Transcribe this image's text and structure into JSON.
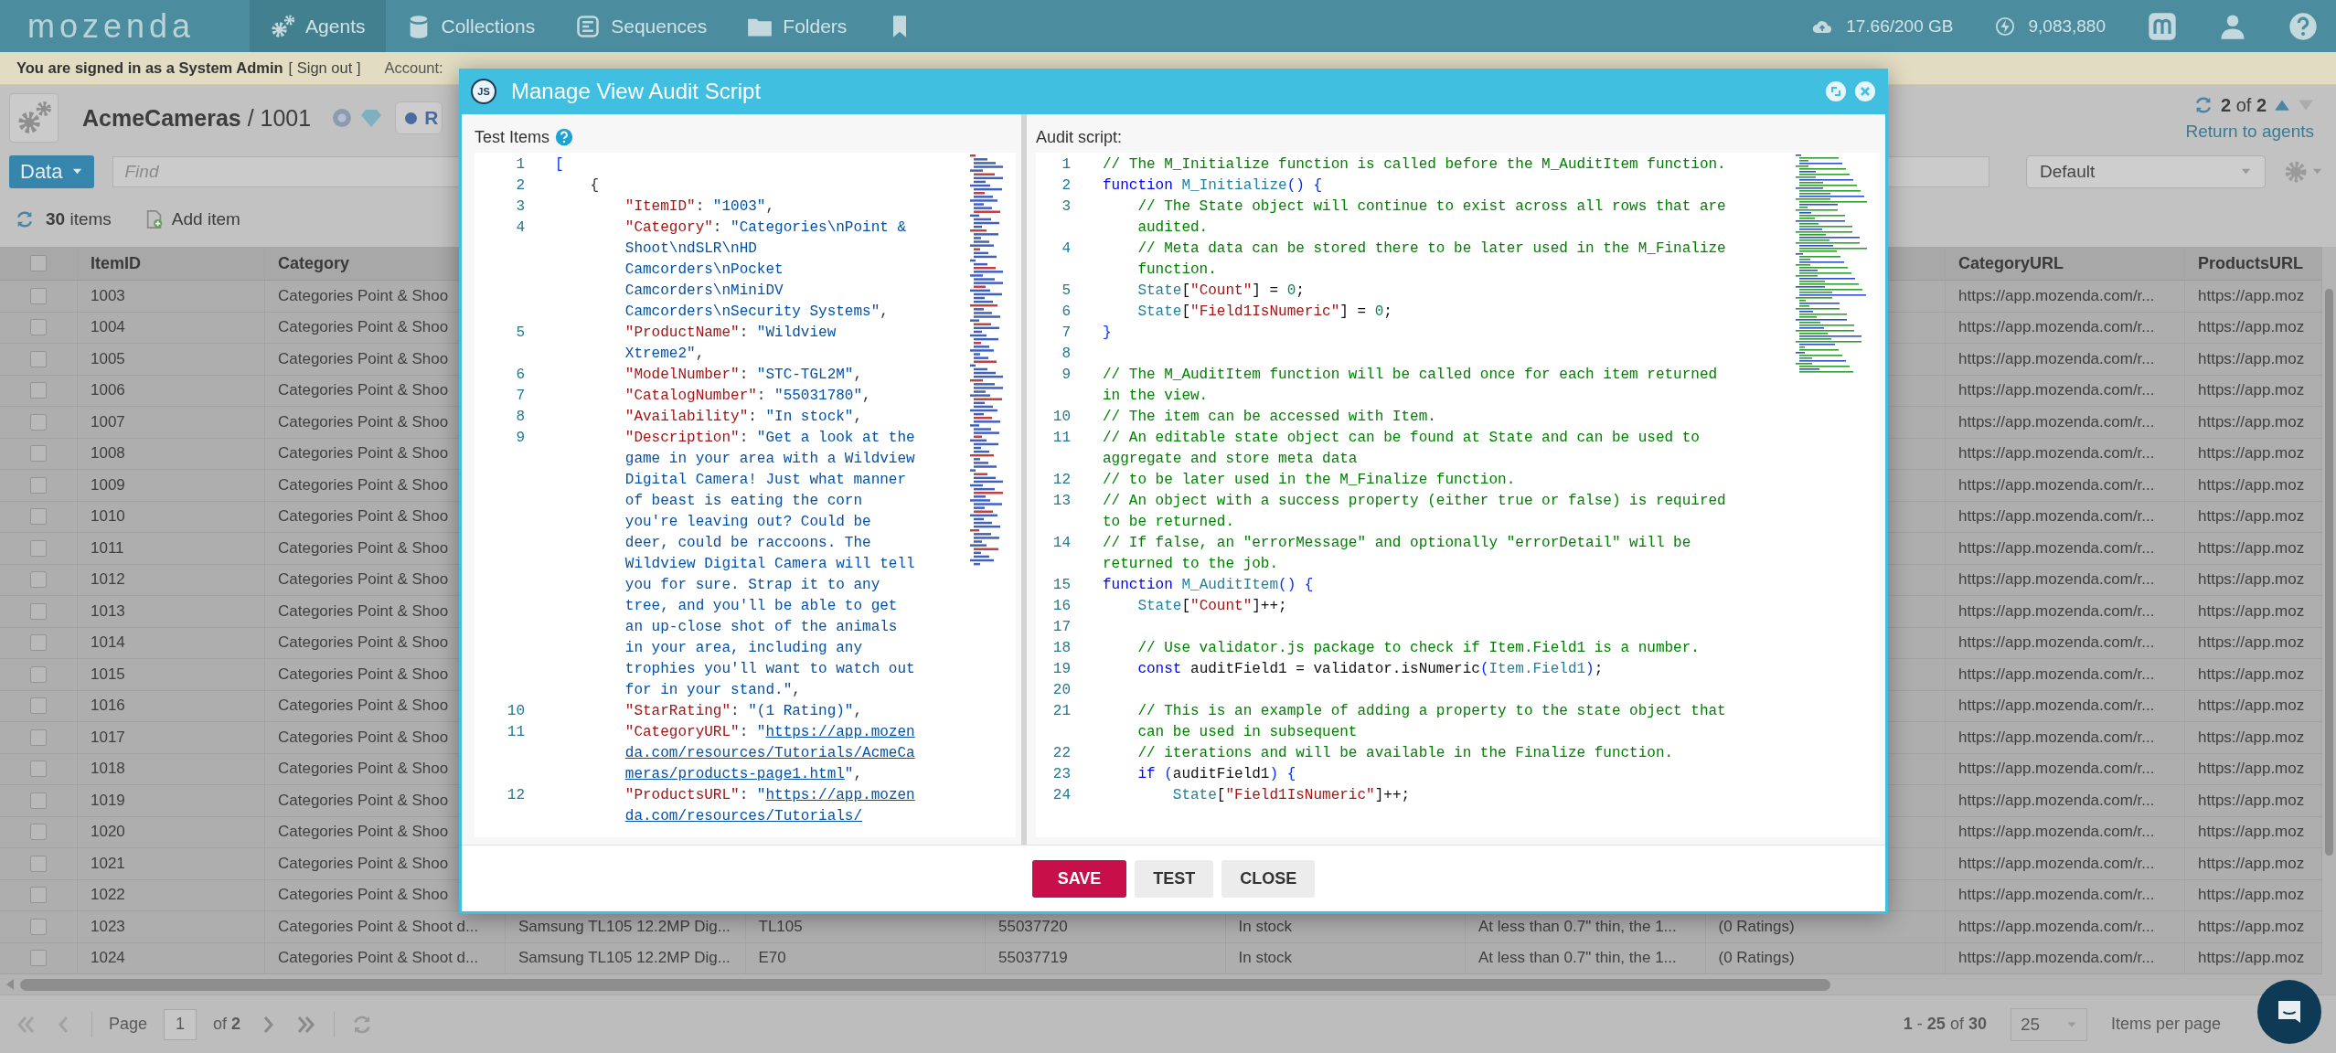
{
  "topbar": {
    "logo": "mozenda",
    "nav": [
      {
        "label": "Agents",
        "selected": true
      },
      {
        "label": "Collections",
        "selected": false
      },
      {
        "label": "Sequences",
        "selected": false
      },
      {
        "label": "Folders",
        "selected": false
      },
      {
        "selected": false
      }
    ],
    "storage": "17.66/200 GB",
    "credits": "9,083,880"
  },
  "admin_bar": {
    "signed_in": "You are signed in as a System Admin",
    "sign_out": "[ Sign out ]",
    "account_label": "Account:"
  },
  "view_header": {
    "title": "**AcmeCameras** / 1001",
    "chip": "R",
    "position": "**2** of **2**",
    "return_link": "Return to agents",
    "data_button": "Data",
    "find_placeholder": "Find",
    "view_select": "Default",
    "item_count": "**30** items",
    "add_item": "Add item"
  },
  "table": {
    "select_all_checked": false,
    "columns_left": [
      "ItemID",
      "Category"
    ],
    "columns_right": [
      "CategoryURL",
      "ProductsURL"
    ],
    "rows": [
      {
        "checked": false,
        "item_id": "1003",
        "category": "Categories Point & Shoo",
        "category_url": "https://app.mozenda.com/r...",
        "products_url": "https://app.moz"
      },
      {
        "checked": false,
        "item_id": "1004",
        "category": "Categories Point & Shoo",
        "category_url": "https://app.mozenda.com/r...",
        "products_url": "https://app.moz"
      },
      {
        "checked": false,
        "item_id": "1005",
        "category": "Categories Point & Shoo",
        "category_url": "https://app.mozenda.com/r...",
        "products_url": "https://app.moz"
      },
      {
        "checked": false,
        "item_id": "1006",
        "category": "Categories Point & Shoo",
        "category_url": "https://app.mozenda.com/r...",
        "products_url": "https://app.moz"
      },
      {
        "checked": false,
        "item_id": "1007",
        "category": "Categories Point & Shoo",
        "category_url": "https://app.mozenda.com/r...",
        "products_url": "https://app.moz"
      },
      {
        "checked": false,
        "item_id": "1008",
        "category": "Categories Point & Shoo",
        "category_url": "https://app.mozenda.com/r...",
        "products_url": "https://app.moz"
      },
      {
        "checked": false,
        "item_id": "1009",
        "category": "Categories Point & Shoo",
        "category_url": "https://app.mozenda.com/r...",
        "products_url": "https://app.moz"
      },
      {
        "checked": false,
        "item_id": "1010",
        "category": "Categories Point & Shoo",
        "category_url": "https://app.mozenda.com/r...",
        "products_url": "https://app.moz"
      },
      {
        "checked": false,
        "item_id": "1011",
        "category": "Categories Point & Shoo",
        "category_url": "https://app.mozenda.com/r...",
        "products_url": "https://app.moz"
      },
      {
        "checked": false,
        "item_id": "1012",
        "category": "Categories Point & Shoo",
        "category_url": "https://app.mozenda.com/r...",
        "products_url": "https://app.moz"
      },
      {
        "checked": false,
        "item_id": "1013",
        "category": "Categories Point & Shoo",
        "category_url": "https://app.mozenda.com/r...",
        "products_url": "https://app.moz"
      },
      {
        "checked": false,
        "item_id": "1014",
        "category": "Categories Point & Shoo",
        "category_url": "https://app.mozenda.com/r...",
        "products_url": "https://app.moz"
      },
      {
        "checked": false,
        "item_id": "1015",
        "category": "Categories Point & Shoo",
        "category_url": "https://app.mozenda.com/r...",
        "products_url": "https://app.moz"
      },
      {
        "checked": false,
        "item_id": "1016",
        "category": "Categories Point & Shoo",
        "category_url": "https://app.mozenda.com/r...",
        "products_url": "https://app.moz"
      },
      {
        "checked": false,
        "item_id": "1017",
        "category": "Categories Point & Shoo",
        "category_url": "https://app.mozenda.com/r...",
        "products_url": "https://app.moz"
      },
      {
        "checked": false,
        "item_id": "1018",
        "category": "Categories Point & Shoo",
        "category_url": "https://app.mozenda.com/r...",
        "products_url": "https://app.moz"
      },
      {
        "checked": false,
        "item_id": "1019",
        "category": "Categories Point & Shoo",
        "category_url": "https://app.mozenda.com/r...",
        "products_url": "https://app.moz"
      },
      {
        "checked": false,
        "item_id": "1020",
        "category": "Categories Point & Shoo",
        "category_url": "https://app.mozenda.com/r...",
        "products_url": "https://app.moz"
      },
      {
        "checked": false,
        "item_id": "1021",
        "category": "Categories Point & Shoo",
        "category_url": "https://app.mozenda.com/r...",
        "products_url": "https://app.moz"
      },
      {
        "checked": false,
        "item_id": "1022",
        "category": "Categories Point & Shoo",
        "category_url": "https://app.mozenda.com/r...",
        "products_url": "https://app.moz"
      },
      {
        "checked": false,
        "item_id": "1023",
        "category": "Categories Point & Shoot d...",
        "column_3": "Samsung TL105 12.2MP Dig...",
        "column_4": "TL105",
        "column_5": "55037720",
        "column_6": "In stock",
        "column_7": "At less than 0.7\" thin, the 1...",
        "column_8": "(0 Ratings)",
        "category_url": "https://app.mozenda.com/r...",
        "products_url": "https://app.moz"
      },
      {
        "checked": false,
        "item_id": "1024",
        "category": "Categories Point & Shoot d...",
        "column_3": "Samsung TL105 12.2MP Dig...",
        "column_4": "E70",
        "column_5": "55037719",
        "column_6": "In stock",
        "column_7": "At less than 0.7\" thin, the 1...",
        "column_8": "(0 Ratings)",
        "category_url": "https://app.mozenda.com/r...",
        "products_url": "https://app.moz"
      }
    ]
  },
  "pager": {
    "page_label": "Page",
    "page": "1",
    "page_total": "of **2**",
    "range": "**1** - **25** of **30**",
    "per_page": "25",
    "per_page_label": "Items per page"
  },
  "modal": {
    "icon_label": "JS",
    "title": "Manage View Audit Script",
    "buttons": [
      {
        "label": "SAVE",
        "kind": "primary"
      },
      {
        "label": "TEST",
        "kind": "plain"
      },
      {
        "label": "CLOSE",
        "kind": "plain"
      }
    ],
    "test_items": {
      "label": "Test Items",
      "lines": [
        {
          "num": "1",
          "tokens": [
            {
              "kind": "bracket",
              "text": "["
            }
          ]
        },
        {
          "num": "2",
          "tokens": [
            {
              "kind": "punct",
              "text": "    {"
            }
          ]
        },
        {
          "num": "3",
          "tokens": [
            {
              "kind": "key",
              "text": "        \"ItemID\""
            },
            {
              "kind": "punct",
              "text": ": "
            },
            {
              "kind": "str",
              "text": "\"1003\""
            },
            {
              "kind": "punct",
              "text": ","
            }
          ]
        },
        {
          "num": "4",
          "tokens": [
            {
              "kind": "key",
              "text": "        \"Category\""
            },
            {
              "kind": "punct",
              "text": ": "
            },
            {
              "kind": "str",
              "text": "\"Categories\\nPoint & Shoot\\ndSLR\\nHD Camcorders\\nPocket Camcorders\\nMiniDV Camcorders\\nSecurity Systems\""
            },
            {
              "kind": "punct",
              "text": ","
            }
          ]
        },
        {
          "num": "5",
          "tokens": [
            {
              "kind": "key",
              "text": "        \"ProductName\""
            },
            {
              "kind": "punct",
              "text": ": "
            },
            {
              "kind": "str",
              "text": "\"Wildview Xtreme2\""
            },
            {
              "kind": "punct",
              "text": ","
            }
          ]
        },
        {
          "num": "6",
          "tokens": [
            {
              "kind": "key",
              "text": "        \"ModelNumber\""
            },
            {
              "kind": "punct",
              "text": ": "
            },
            {
              "kind": "str",
              "text": "\"STC-TGL2M\""
            },
            {
              "kind": "punct",
              "text": ","
            }
          ]
        },
        {
          "num": "7",
          "tokens": [
            {
              "kind": "key",
              "text": "        \"CatalogNumber\""
            },
            {
              "kind": "punct",
              "text": ": "
            },
            {
              "kind": "str",
              "text": "\"55031780\""
            },
            {
              "kind": "punct",
              "text": ","
            }
          ]
        },
        {
          "num": "8",
          "tokens": [
            {
              "kind": "key",
              "text": "        \"Availability\""
            },
            {
              "kind": "punct",
              "text": ": "
            },
            {
              "kind": "str",
              "text": "\"In stock\""
            },
            {
              "kind": "punct",
              "text": ","
            }
          ]
        },
        {
          "num": "9",
          "tokens": [
            {
              "kind": "key",
              "text": "        \"Description\""
            },
            {
              "kind": "punct",
              "text": ": "
            },
            {
              "kind": "str",
              "text": "\"Get a look at the game in your area with a Wildview Digital Camera! Just what manner of beast is eating the corn you're leaving out? Could be deer, could be raccoons. The Wildview Digital Camera will tell you for sure. Strap it to any tree, and you'll be able to get an up-close shot of the animals in your area, including any trophies you'll want to watch out for in your stand.\""
            },
            {
              "kind": "punct",
              "text": ","
            }
          ]
        },
        {
          "num": "10",
          "tokens": [
            {
              "kind": "key",
              "text": "        \"StarRating\""
            },
            {
              "kind": "punct",
              "text": ": "
            },
            {
              "kind": "str",
              "text": "\"(1 Rating)\""
            },
            {
              "kind": "punct",
              "text": ","
            }
          ]
        },
        {
          "num": "11",
          "tokens": [
            {
              "kind": "key",
              "text": "        \"CategoryURL\""
            },
            {
              "kind": "punct",
              "text": ": "
            },
            {
              "kind": "str",
              "text": "\""
            },
            {
              "kind": "link",
              "text": "https://app.mozenda.com/resources/Tutorials/AcmeCameras/products-page1.html"
            },
            {
              "kind": "str",
              "text": "\""
            },
            {
              "kind": "punct",
              "text": ","
            }
          ]
        },
        {
          "num": "12",
          "tokens": [
            {
              "kind": "key",
              "text": "        \"ProductsURL\""
            },
            {
              "kind": "punct",
              "text": ": "
            },
            {
              "kind": "str",
              "text": "\""
            },
            {
              "kind": "link",
              "text": "https://app.mozenda.com/resources/Tutorials/"
            }
          ]
        }
      ]
    },
    "audit_script": {
      "label": "Audit script:",
      "lines": [
        {
          "num": "1",
          "tokens": [
            {
              "kind": "comment",
              "text": "// The M_Initialize function is called before the M_AuditItem function."
            }
          ]
        },
        {
          "num": "2",
          "tokens": [
            {
              "kind": "keyword",
              "text": "function "
            },
            {
              "kind": "type",
              "text": "M_Initialize"
            },
            {
              "kind": "bracket",
              "text": "() {"
            }
          ]
        },
        {
          "num": "3",
          "tokens": [
            {
              "kind": "comment",
              "text": "    // The State object will continue to exist across all rows that are audited."
            }
          ]
        },
        {
          "num": "4",
          "tokens": [
            {
              "kind": "comment",
              "text": "    // Meta data can be stored there to be later used in the M_Finalize function."
            }
          ]
        },
        {
          "num": "5",
          "tokens": [
            {
              "kind": "type",
              "text": "    State"
            },
            {
              "kind": "plain",
              "text": "["
            },
            {
              "kind": "key",
              "text": "\"Count\""
            },
            {
              "kind": "plain",
              "text": "] = "
            },
            {
              "kind": "num",
              "text": "0"
            },
            {
              "kind": "plain",
              "text": ";"
            }
          ]
        },
        {
          "num": "6",
          "tokens": [
            {
              "kind": "type",
              "text": "    State"
            },
            {
              "kind": "plain",
              "text": "["
            },
            {
              "kind": "key",
              "text": "\"Field1IsNumeric\""
            },
            {
              "kind": "plain",
              "text": "] = "
            },
            {
              "kind": "num",
              "text": "0"
            },
            {
              "kind": "plain",
              "text": ";"
            }
          ]
        },
        {
          "num": "7",
          "tokens": [
            {
              "kind": "bracket",
              "text": "}"
            }
          ]
        },
        {
          "num": "8"
        },
        {
          "num": "9",
          "tokens": [
            {
              "kind": "comment",
              "text": "// The M_AuditItem function will be called once for each item returned in the view."
            }
          ]
        },
        {
          "num": "10",
          "tokens": [
            {
              "kind": "comment",
              "text": "// The item can be accessed with Item."
            }
          ]
        },
        {
          "num": "11",
          "tokens": [
            {
              "kind": "comment",
              "text": "// An editable state object can be found at State and can be used to aggregate and store meta data"
            }
          ]
        },
        {
          "num": "12",
          "tokens": [
            {
              "kind": "comment",
              "text": "// to be later used in the M_Finalize function."
            }
          ]
        },
        {
          "num": "13",
          "tokens": [
            {
              "kind": "comment",
              "text": "// An object with a success property (either true or false) is required to be returned."
            }
          ]
        },
        {
          "num": "14",
          "tokens": [
            {
              "kind": "comment",
              "text": "// If false, an \"errorMessage\" and optionally \"errorDetail\" will be returned to the job."
            }
          ]
        },
        {
          "num": "15",
          "tokens": [
            {
              "kind": "keyword",
              "text": "function "
            },
            {
              "kind": "type",
              "text": "M_AuditItem"
            },
            {
              "kind": "bracket",
              "text": "() {"
            }
          ]
        },
        {
          "num": "16",
          "tokens": [
            {
              "kind": "type",
              "text": "    State"
            },
            {
              "kind": "plain",
              "text": "["
            },
            {
              "kind": "key",
              "text": "\"Count\""
            },
            {
              "kind": "plain",
              "text": "]++;"
            }
          ]
        },
        {
          "num": "17"
        },
        {
          "num": "18",
          "tokens": [
            {
              "kind": "comment",
              "text": "    // Use validator.js package to check if Item.Field1 is a number."
            }
          ]
        },
        {
          "num": "19",
          "tokens": [
            {
              "kind": "keyword",
              "text": "    const"
            },
            {
              "kind": "plain",
              "text": " auditField1 = validator.isNumeric"
            },
            {
              "kind": "bracket",
              "text": "("
            },
            {
              "kind": "type",
              "text": "Item.Field1"
            },
            {
              "kind": "bracket",
              "text": ")"
            },
            {
              "kind": "plain",
              "text": ";"
            }
          ]
        },
        {
          "num": "20"
        },
        {
          "num": "21",
          "tokens": [
            {
              "kind": "comment",
              "text": "    // This is an example of adding a property to the state object that can be used in subsequent"
            }
          ]
        },
        {
          "num": "22",
          "tokens": [
            {
              "kind": "comment",
              "text": "    // iterations and will be available in the Finalize function."
            }
          ]
        },
        {
          "num": "23",
          "tokens": [
            {
              "kind": "keyword",
              "text": "    if "
            },
            {
              "kind": "bracket",
              "text": "("
            },
            {
              "kind": "plain",
              "text": "auditField1"
            },
            {
              "kind": "bracket",
              "text": ") {"
            }
          ]
        },
        {
          "num": "24",
          "tokens": [
            {
              "kind": "type",
              "text": "        State"
            },
            {
              "kind": "plain",
              "text": "["
            },
            {
              "kind": "key",
              "text": "\"Field1IsNumeric\""
            },
            {
              "kind": "plain",
              "text": "]++;"
            }
          ]
        }
      ]
    }
  }
}
